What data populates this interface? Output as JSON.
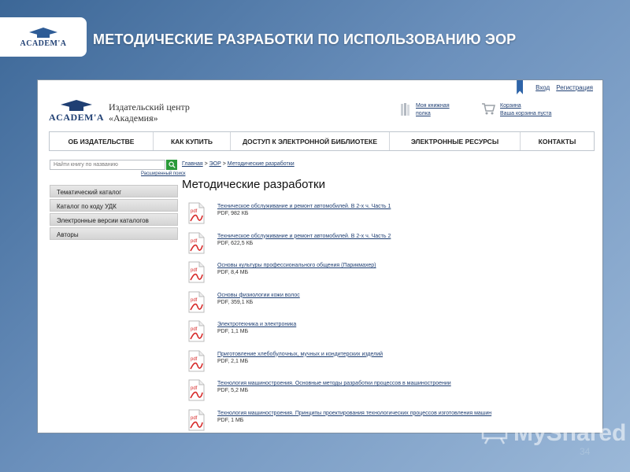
{
  "slide": {
    "title": "МЕТОДИЧЕСКИЕ РАЗРАБОТКИ ПО ИСПОЛЬЗОВАНИЮ ЭОР",
    "logo_text": "ACADEM'A",
    "page_number": "34",
    "watermark": "MyShared"
  },
  "site": {
    "logo_text": "ACADEM'A",
    "publisher_line1": "Издательский центр",
    "publisher_line2": "«Академия»",
    "top_links": {
      "login": "Вход",
      "register": "Регистрация"
    },
    "shelf": {
      "line1": "Моя книжная",
      "line2": "полка"
    },
    "cart": {
      "line1": "Корзина",
      "line2": "Ваша корзина пуста"
    },
    "nav": [
      "ОБ ИЗДАТЕЛЬСТВЕ",
      "КАК КУПИТЬ",
      "ДОСТУП К ЭЛЕКТРОННОЙ БИБЛИОТЕКЕ",
      "ЭЛЕКТРОННЫЕ РЕСУРСЫ",
      "КОНТАКТЫ"
    ],
    "search": {
      "placeholder": "Найти книгу по названию",
      "advanced": "Расширенный поиск"
    },
    "side_menu": [
      "Тематический каталог",
      "Каталог по коду УДК",
      "Электронные версии каталогов",
      "Авторы"
    ],
    "breadcrumb": {
      "home": "Главная",
      "sep": " > ",
      "eor": "ЭОР",
      "current": "Методические разработки"
    },
    "heading": "Методические разработки",
    "documents": [
      {
        "title": "Техническое обслуживание и ремонт автомобилей. В 2-х ч. Часть 1",
        "meta": "PDF, 982 КБ"
      },
      {
        "title": "Техническое обслуживание и ремонт автомобилей. В 2-х ч. Часть 2",
        "meta": "PDF, 622,5 КБ"
      },
      {
        "title": "Основы культуры профессионального общения (Парикмахер)",
        "meta": "PDF, 8,4 МБ"
      },
      {
        "title": "Основы физиологии кожи волос",
        "meta": "PDF, 359,1 КБ"
      },
      {
        "title": "Электротехника и электроника",
        "meta": "PDF, 1,1 МБ"
      },
      {
        "title": "Приготовление хлебобулочных, мучных и кондитерских изделий",
        "meta": "PDF, 2,1 МБ"
      },
      {
        "title": "Технология машиностроения. Основные методы разработки процессов в машиностроении",
        "meta": "PDF, 5,2 МБ"
      },
      {
        "title": "Технология машиностроения. Принципы проектирования технологических процессов изготовления машин",
        "meta": "PDF, 1 МБ"
      }
    ],
    "pdf_icon_label": "pdf"
  },
  "colors": {
    "link": "#1f3f73",
    "search_button": "#2a9a3a",
    "pdf_red": "#d72a2a"
  }
}
